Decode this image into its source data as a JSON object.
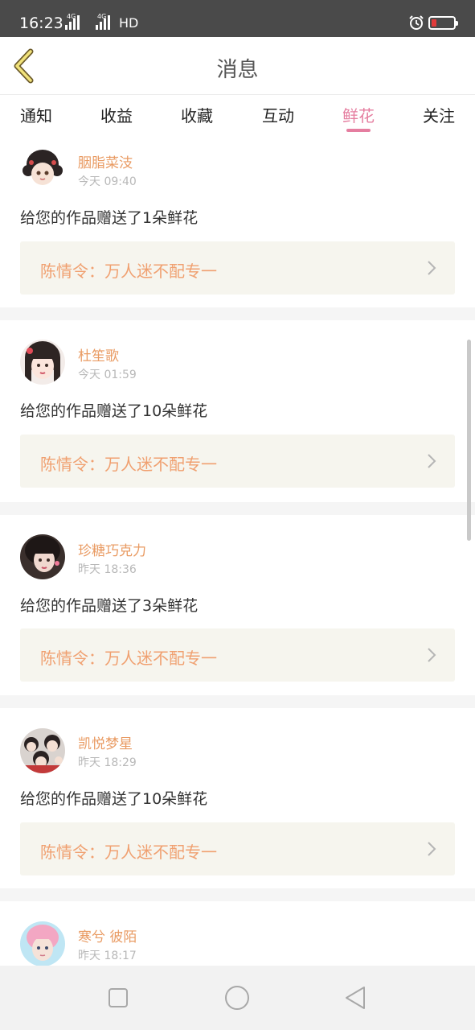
{
  "status_bar": {
    "time": "16:23",
    "network_1": "4G",
    "network_2": "4G",
    "hd": "HD",
    "alarm_icon": "alarm-icon",
    "battery_icon": "battery-low-icon",
    "battery_color": "#e23b3b"
  },
  "header": {
    "title": "消息",
    "back_icon": "chevron-left-icon"
  },
  "tabs": [
    {
      "label": "通知",
      "active": false
    },
    {
      "label": "收益",
      "active": false
    },
    {
      "label": "收藏",
      "active": false
    },
    {
      "label": "互动",
      "active": false
    },
    {
      "label": "鲜花",
      "active": true
    },
    {
      "label": "关注",
      "active": false
    }
  ],
  "accent_color": "#e57ea0",
  "notifications": [
    {
      "username": "胭脂菜汥",
      "time": "今天 09:40",
      "message": "给您的作品赠送了1朵鲜花",
      "work_title": "陈情令：万人迷不配专一"
    },
    {
      "username": "杜笙歌",
      "time": "今天 01:59",
      "message": "给您的作品赠送了10朵鲜花",
      "work_title": "陈情令：万人迷不配专一"
    },
    {
      "username": "珍糖巧克力",
      "time": "昨天 18:36",
      "message": "给您的作品赠送了3朵鲜花",
      "work_title": "陈情令：万人迷不配专一"
    },
    {
      "username": "凯悦梦星",
      "time": "昨天 18:29",
      "message": "给您的作品赠送了10朵鲜花",
      "work_title": "陈情令：万人迷不配专一"
    },
    {
      "username": "寒兮 彼陌",
      "time": "昨天 18:17",
      "message": "",
      "work_title": ""
    }
  ],
  "nav_bar": {
    "recent_icon": "square-icon",
    "home_icon": "circle-icon",
    "back_icon": "triangle-back-icon"
  }
}
